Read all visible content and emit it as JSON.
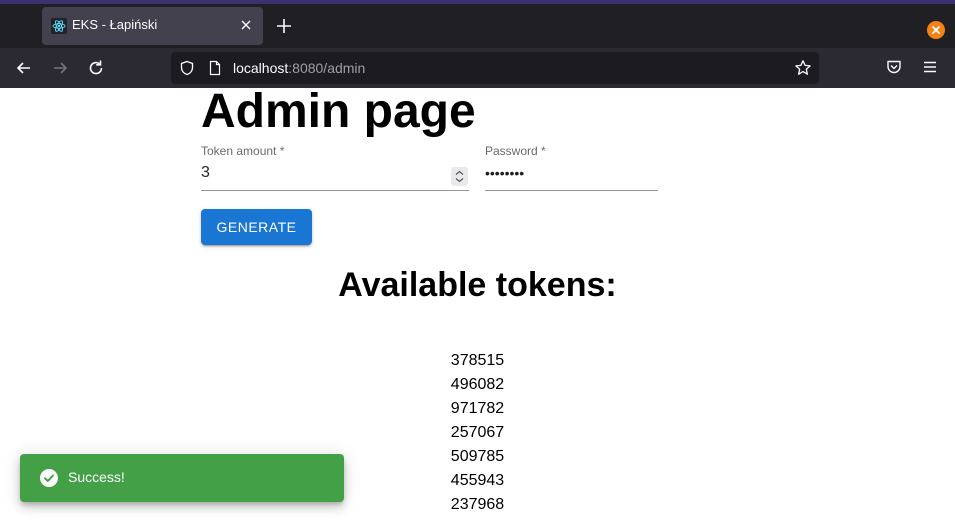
{
  "browser": {
    "tab_title": "EKS - Łapiński",
    "url_host": "localhost",
    "url_rest": ":8080/admin",
    "icons": {
      "favicon": "react-logo-icon",
      "tab_close": "close-icon",
      "new_tab": "plus-icon",
      "window_close": "window-close-icon",
      "back": "arrow-left-icon",
      "forward": "arrow-right-icon",
      "reload": "reload-icon",
      "tracking": "shield-icon",
      "page_info": "page-icon",
      "bookmark": "star-icon",
      "pocket": "pocket-icon",
      "menu": "hamburger-menu-icon"
    },
    "colors": {
      "accent": "#3b3170",
      "window_close": "#f38118"
    }
  },
  "page": {
    "title": "Admin page",
    "form": {
      "token_amount_label": "Token amount *",
      "token_amount_value": "3",
      "password_label": "Password *",
      "password_value": "••••••••",
      "generate_label": "GENERATE"
    },
    "tokens_heading": "Available tokens:",
    "tokens": [
      "378515",
      "496082",
      "971782",
      "257067",
      "509785",
      "455943",
      "237968"
    ]
  },
  "snackbar": {
    "message": "Success!",
    "icon": "check-circle-icon",
    "color": "#43a047"
  },
  "colors": {
    "primary_button": "#1976d2"
  }
}
